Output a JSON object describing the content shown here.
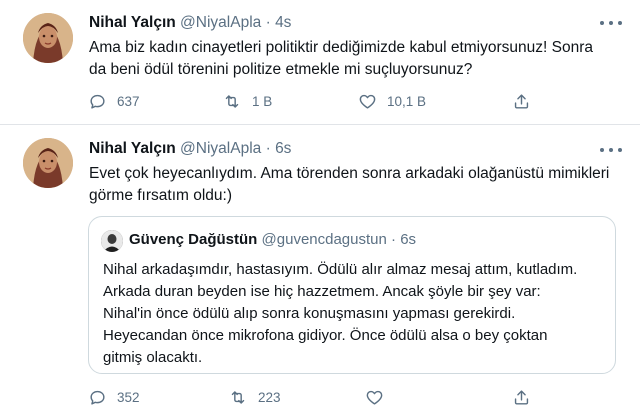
{
  "tweets": [
    {
      "author_name": "Nihal Yalçın",
      "handle": "@NiyalApla",
      "separator": "·",
      "time": "4s",
      "text_lines": [
        "Ama biz kadın cinayetleri politiktir dediğimizde kabul etmiyorsunuz! Sonra",
        "da beni ödül törenini politize etmekle mi suçluyorsunuz?"
      ],
      "reply_count": "637",
      "retweet_count": "1 B",
      "like_count": "10,1 B"
    },
    {
      "author_name": "Nihal Yalçın",
      "handle": "@NiyalApla",
      "separator": "·",
      "time": "6s",
      "text_lines": [
        "Evet çok heyecanlıydım. Ama törenden sonra arkadaki olağanüstü mimikleri",
        "görme fırsatım oldu:)"
      ],
      "reply_count": "352",
      "retweet_count": "223",
      "like_count": "",
      "quoted": {
        "author_name": "Güvenç Dağüstün",
        "handle": "@guvencdagustun",
        "separator": "·",
        "time": "6s",
        "text_lines": [
          "Nihal arkadaşımdır, hastasıyım. Ödülü alır almaz mesaj attım, kutladım.",
          "Arkada duran beyden ise hiç hazzetmem. Ancak şöyle bir şey var:",
          "Nihal'in önce ödülü alıp sonra konuşmasını yapması gerekirdi.",
          "Heyecandan önce mikrofona gidiyor. Önce ödülü alsa o bey çoktan",
          "gitmiş olacaktı."
        ]
      }
    }
  ],
  "icons": {
    "more": "more-horizontal-icon",
    "reply": "reply-bubble-icon",
    "retweet": "retweet-icon",
    "like": "heart-icon",
    "share": "share-upload-icon"
  },
  "colors": {
    "text": "#0f1419",
    "secondary": "#5b7083",
    "border": "#e1e4e8"
  }
}
